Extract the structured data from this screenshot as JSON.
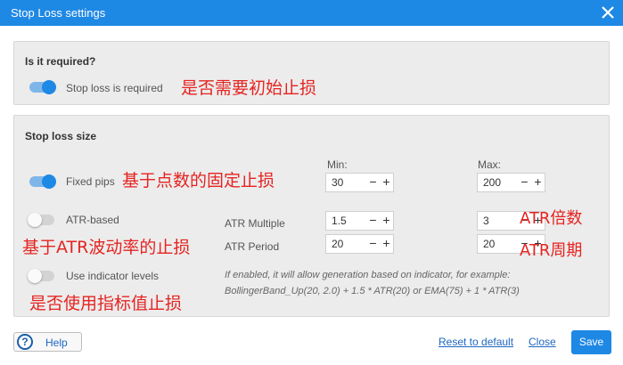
{
  "dialog": {
    "title": "Stop Loss settings"
  },
  "required_section": {
    "title": "Is it required?",
    "toggle_on": true,
    "toggle_label": "Stop loss is required",
    "annotation": "是否需要初始止损"
  },
  "size_section": {
    "title": "Stop loss size",
    "min_header": "Min:",
    "max_header": "Max:",
    "fixed_pips": {
      "toggle_on": true,
      "label": "Fixed pips",
      "annotation": "基于点数的固定止损",
      "min_value": "30",
      "max_value": "200"
    },
    "atr_based": {
      "toggle_on": false,
      "label": "ATR-based",
      "annotation": "基于ATR波动率的止损",
      "multiple_label": "ATR Multiple",
      "multiple_min": "1.5",
      "multiple_max": "3",
      "multiple_annotation": "ATR倍数",
      "period_label": "ATR Period",
      "period_min": "20",
      "period_max": "20",
      "period_annotation": "ATR周期"
    },
    "indicator_levels": {
      "toggle_on": false,
      "label": "Use indicator levels",
      "annotation": "是否使用指标值止损",
      "hint_line1": "If enabled, it will allow generation based on indicator, for example:",
      "hint_line2": "BollingerBand_Up(20, 2.0) + 1.5 * ATR(20) or EMA(75) + 1 * ATR(3)"
    }
  },
  "stepper": {
    "minus": "−",
    "plus": "+"
  },
  "footer": {
    "help_icon": "?",
    "help_label": "Help",
    "reset_label": "Reset to default",
    "close_label": "Close",
    "save_label": "Save"
  },
  "colors": {
    "accent": "#1e88e5",
    "annotation": "#e52421",
    "panel": "#ececec"
  }
}
